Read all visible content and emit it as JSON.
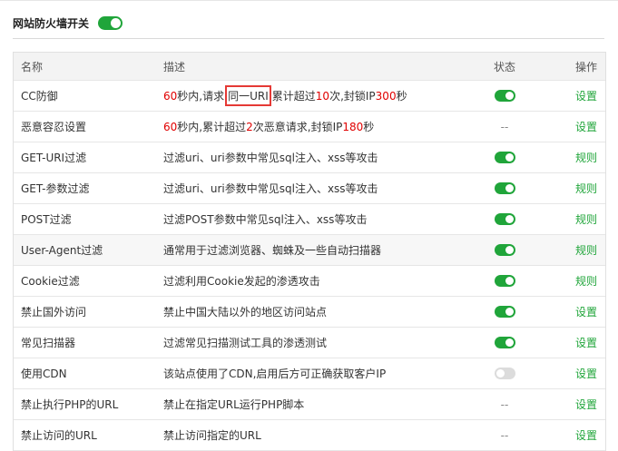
{
  "header": {
    "title": "网站防火墙开关",
    "switch_on": true
  },
  "table": {
    "columns": {
      "name": "名称",
      "desc": "描述",
      "status": "状态",
      "op": "操作"
    },
    "rows": [
      {
        "name": "CC防御",
        "desc": {
          "v1": "60",
          "t1": " 秒内,请求",
          "boxed": "同一URI",
          "t2": "累计超过 ",
          "v2": "10",
          "t3": " 次,封锁IP ",
          "v3": "300",
          "t4": " 秒"
        },
        "status": "on",
        "action": "设置"
      },
      {
        "name": "恶意容忍设置",
        "desc": {
          "v1": "60",
          "t1": " 秒内,累计超过 ",
          "v2": "2",
          "t2": " 次恶意请求,封锁IP ",
          "v3": "180",
          "t3": " 秒"
        },
        "status": "--",
        "action": "设置"
      },
      {
        "name": "GET-URI过滤",
        "desc": "过滤uri、uri参数中常见sql注入、xss等攻击",
        "status": "on",
        "action": "规则"
      },
      {
        "name": "GET-参数过滤",
        "desc": "过滤uri、uri参数中常见sql注入、xss等攻击",
        "status": "on",
        "action": "规则"
      },
      {
        "name": "POST过滤",
        "desc": "过滤POST参数中常见sql注入、xss等攻击",
        "status": "on",
        "action": "规则"
      },
      {
        "name": "User-Agent过滤",
        "desc": "通常用于过滤浏览器、蜘蛛及一些自动扫描器",
        "status": "on",
        "action": "规则"
      },
      {
        "name": "Cookie过滤",
        "desc": "过滤利用Cookie发起的渗透攻击",
        "status": "on",
        "action": "规则"
      },
      {
        "name": "禁止国外访问",
        "desc": "禁止中国大陆以外的地区访问站点",
        "status": "on",
        "action": "设置"
      },
      {
        "name": "常见扫描器",
        "desc": "过滤常见扫描测试工具的渗透测试",
        "status": "on",
        "action": "设置"
      },
      {
        "name": "使用CDN",
        "desc": "该站点使用了CDN,启用后方可正确获取客户IP",
        "status": "off",
        "action": "设置"
      },
      {
        "name": "禁止执行PHP的URL",
        "desc": "禁止在指定URL运行PHP脚本",
        "status": "--",
        "action": "设置"
      },
      {
        "name": "禁止访问的URL",
        "desc": "禁止访问指定的URL",
        "status": "--",
        "action": "设置"
      }
    ]
  },
  "colors": {
    "accent": "#20a53a",
    "value_red": "#e00000",
    "highlight_box": "#e53935"
  }
}
